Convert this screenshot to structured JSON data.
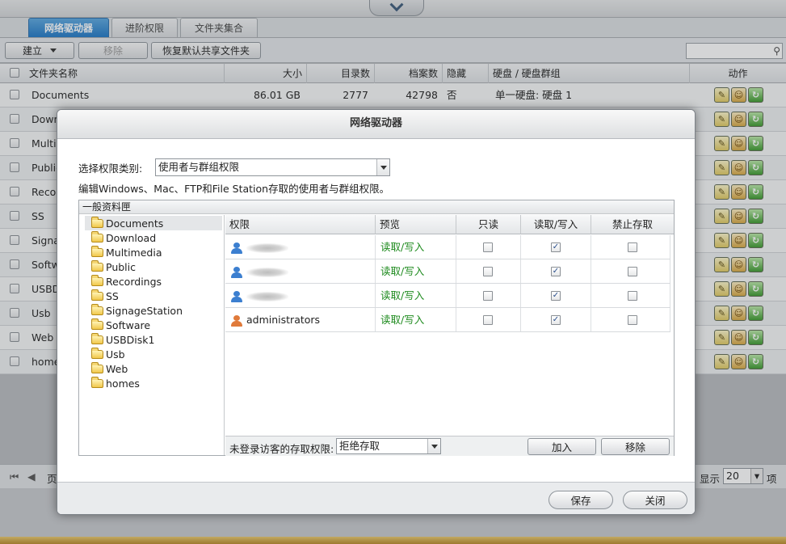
{
  "tabs": [
    {
      "label": "网络驱动器",
      "active": true
    },
    {
      "label": "进阶权限",
      "active": false
    },
    {
      "label": "文件夹集合",
      "active": false
    }
  ],
  "toolbar": {
    "create_label": "建立",
    "remove_label": "移除",
    "restore_label": "恢复默认共享文件夹",
    "search_placeholder": ""
  },
  "grid": {
    "headers": {
      "name": "文件夹名称",
      "size": "大小",
      "dirs": "目录数",
      "files": "档案数",
      "hidden": "隐藏",
      "volume": "硬盘 / 硬盘群组",
      "action": "动作"
    },
    "rows": [
      {
        "name": "Documents",
        "size": "86.01 GB",
        "dirs": "2777",
        "files": "42798",
        "hidden": "否",
        "volume": "单一硬盘: 硬盘 1"
      },
      {
        "name": "Downl"
      },
      {
        "name": "Multim"
      },
      {
        "name": "Public"
      },
      {
        "name": "Recor"
      },
      {
        "name": "SS"
      },
      {
        "name": "Signa"
      },
      {
        "name": "Softw"
      },
      {
        "name": "USBD"
      },
      {
        "name": "Usb"
      },
      {
        "name": "Web"
      },
      {
        "name": "home"
      }
    ]
  },
  "pager": {
    "page_label": "页",
    "show_label": "显示",
    "page_size": "20",
    "items_label": "项目"
  },
  "dialog": {
    "title": "网络驱动器",
    "perm_type_label": "选择权限类别:",
    "perm_type_value": "使用者与群组权限",
    "description": "编辑Windows、Mac、FTP和File Station存取的使用者与群组权限。",
    "panel_title": "一般资料匣",
    "folders": [
      "Documents",
      "Download",
      "Multimedia",
      "Public",
      "Recordings",
      "SS",
      "SignageStation",
      "Software",
      "USBDisk1",
      "Usb",
      "Web",
      "homes"
    ],
    "selected_folder": "Documents",
    "perm_headers": {
      "perm": "权限",
      "preview": "预览",
      "readonly": "只读",
      "readwrite": "读取/写入",
      "deny": "禁止存取"
    },
    "perm_rows": [
      {
        "type": "user",
        "name": "",
        "preview": "读取/写入",
        "readonly": false,
        "readwrite": true,
        "deny": false
      },
      {
        "type": "user",
        "name": "",
        "preview": "读取/写入",
        "readonly": false,
        "readwrite": true,
        "deny": false
      },
      {
        "type": "user",
        "name": "",
        "preview": "读取/写入",
        "readonly": false,
        "readwrite": true,
        "deny": false
      },
      {
        "type": "group",
        "name": "administrators",
        "preview": "读取/写入",
        "readonly": false,
        "readwrite": true,
        "deny": false
      }
    ],
    "guest_label": "未登录访客的存取权限:",
    "guest_value": "拒绝存取",
    "add_label": "加入",
    "remove_label": "移除",
    "save_label": "保存",
    "close_label": "关闭"
  },
  "colors": {
    "accent": "#1f78c6",
    "preview_green": "#1d8a1d",
    "user_icon": "#3c7fd0",
    "group_icon": "#e07a3a"
  }
}
